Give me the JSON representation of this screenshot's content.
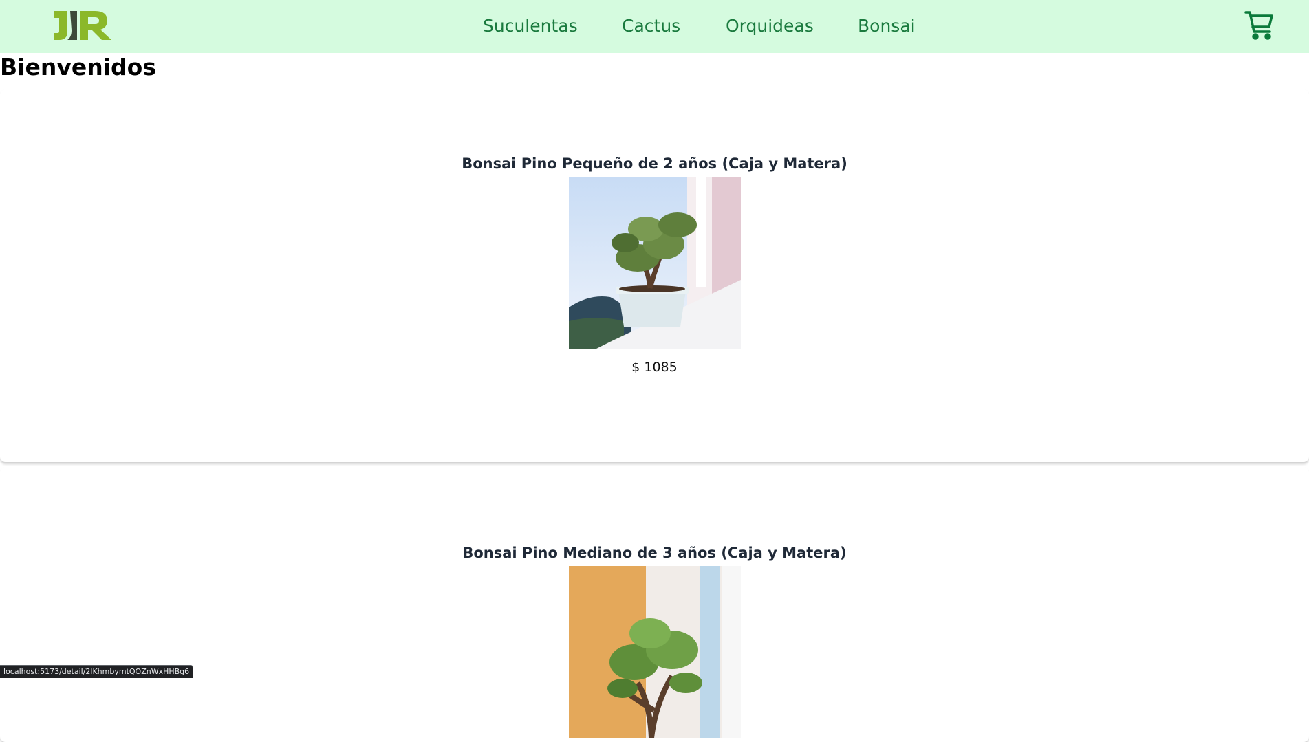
{
  "brand": {
    "logo_text": "JR",
    "logo_colors": [
      "#8bb82a",
      "#3d4a3a"
    ]
  },
  "nav": {
    "links": [
      {
        "label": "Suculentas"
      },
      {
        "label": "Cactus"
      },
      {
        "label": "Orquideas"
      },
      {
        "label": "Bonsai"
      }
    ],
    "cart_icon": "shopping-cart-icon"
  },
  "page": {
    "title": "Bienvenidos"
  },
  "products": [
    {
      "name": "Bonsai Pino Pequeño de 2 años (Caja y Matera)",
      "price": "$ 1085",
      "image": "bonsai-pine-small-photo"
    },
    {
      "name": "Bonsai Pino Mediano de 3 años (Caja y Matera)",
      "price": "",
      "image": "bonsai-jade-medium-photo"
    }
  ],
  "status_bar": {
    "url": "localhost:5173/detail/2lKhmbymtQOZnWxHHBg6"
  },
  "colors": {
    "nav_bg": "#d5fbdf",
    "nav_link": "#1a7a3e",
    "title": "#1f2937"
  }
}
